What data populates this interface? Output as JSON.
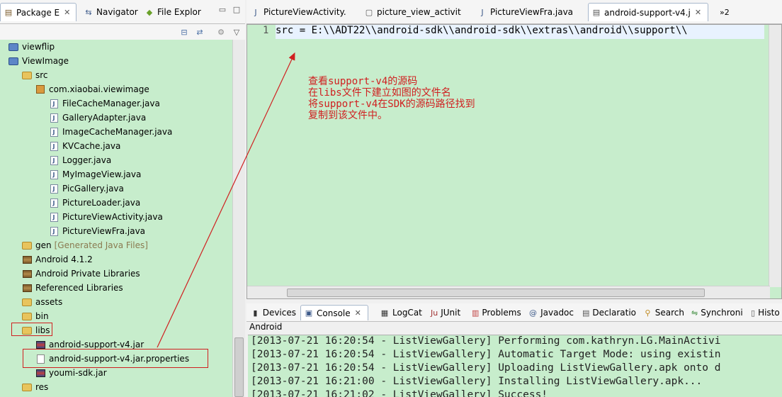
{
  "left_tabs": [
    {
      "label": "Package E",
      "icon": "package-explorer-icon"
    },
    {
      "label": "Navigator",
      "icon": "navigator-icon"
    },
    {
      "label": "File Explor",
      "icon": "android-icon"
    }
  ],
  "tree": [
    {
      "label": "viewflip",
      "icon": "project",
      "indent": 0
    },
    {
      "label": "ViewImage",
      "icon": "project",
      "indent": 0
    },
    {
      "label": "src",
      "icon": "folder",
      "indent": 1
    },
    {
      "label": "com.xiaobai.viewimage",
      "icon": "package",
      "indent": 2
    },
    {
      "label": "FileCacheManager.java",
      "icon": "java",
      "indent": 3
    },
    {
      "label": "GalleryAdapter.java",
      "icon": "java",
      "indent": 3
    },
    {
      "label": "ImageCacheManager.java",
      "icon": "java",
      "indent": 3
    },
    {
      "label": "KVCache.java",
      "icon": "java",
      "indent": 3
    },
    {
      "label": "Logger.java",
      "icon": "java",
      "indent": 3
    },
    {
      "label": "MyImageView.java",
      "icon": "java",
      "indent": 3
    },
    {
      "label": "PicGallery.java",
      "icon": "java",
      "indent": 3
    },
    {
      "label": "PictureLoader.java",
      "icon": "java",
      "indent": 3
    },
    {
      "label": "PictureViewActivity.java",
      "icon": "java",
      "indent": 3
    },
    {
      "label": "PictureViewFra.java",
      "icon": "java",
      "indent": 3
    },
    {
      "label": "gen",
      "hint": "[Generated Java Files]",
      "icon": "folder",
      "indent": 1
    },
    {
      "label": "Android 4.1.2",
      "icon": "lib",
      "indent": 1
    },
    {
      "label": "Android Private Libraries",
      "icon": "lib",
      "indent": 1
    },
    {
      "label": "Referenced Libraries",
      "icon": "lib",
      "indent": 1
    },
    {
      "label": "assets",
      "icon": "folder",
      "indent": 1
    },
    {
      "label": "bin",
      "icon": "folder",
      "indent": 1
    },
    {
      "label": "libs",
      "icon": "folder",
      "indent": 1
    },
    {
      "label": "android-support-v4.jar",
      "icon": "jar",
      "indent": 2
    },
    {
      "label": "android-support-v4.jar.properties",
      "icon": "file",
      "indent": 2
    },
    {
      "label": "youmi-sdk.jar",
      "icon": "jar",
      "indent": 2
    },
    {
      "label": "res",
      "icon": "folder",
      "indent": 1
    }
  ],
  "editor_tabs": [
    {
      "label": "PictureViewActivity."
    },
    {
      "label": "picture_view_activit"
    },
    {
      "label": "PictureViewFra.java"
    },
    {
      "label": "android-support-v4.j",
      "active": true
    }
  ],
  "editor_overflow": "»2",
  "editor": {
    "line_number": "1",
    "code": "src = E:\\\\ADT22\\\\android-sdk\\\\android-sdk\\\\extras\\\\android\\\\support\\\\",
    "annotation": "查看support-v4的源码\n在libs文件下建立如图的文件名\n将support-v4在SDK的源码路径找到\n复制到该文件中。"
  },
  "console_tabs": [
    {
      "label": "Devices"
    },
    {
      "label": "Console",
      "active": true
    },
    {
      "label": "LogCat"
    },
    {
      "label": "JUnit",
      "prefix": "Ju"
    },
    {
      "label": "Problems"
    },
    {
      "label": "Javadoc",
      "prefix": "@"
    },
    {
      "label": "Declaratio"
    },
    {
      "label": "Search"
    },
    {
      "label": "Synchroni"
    },
    {
      "label": "Histo"
    }
  ],
  "console_title": "Android",
  "console_lines": [
    "[2013-07-21 16:20:54 - ListViewGallery] Performing com.kathryn.LG.MainActivi",
    "[2013-07-21 16:20:54 - ListViewGallery] Automatic Target Mode: using existin",
    "[2013-07-21 16:20:54 - ListViewGallery] Uploading ListViewGallery.apk onto d",
    "[2013-07-21 16:21:00 - ListViewGallery] Installing ListViewGallery.apk...",
    "[2013-07-21 16:21:02 - ListViewGallery] Success!"
  ],
  "colors": {
    "background": "#c7edcc",
    "annotation": "#d02020"
  }
}
